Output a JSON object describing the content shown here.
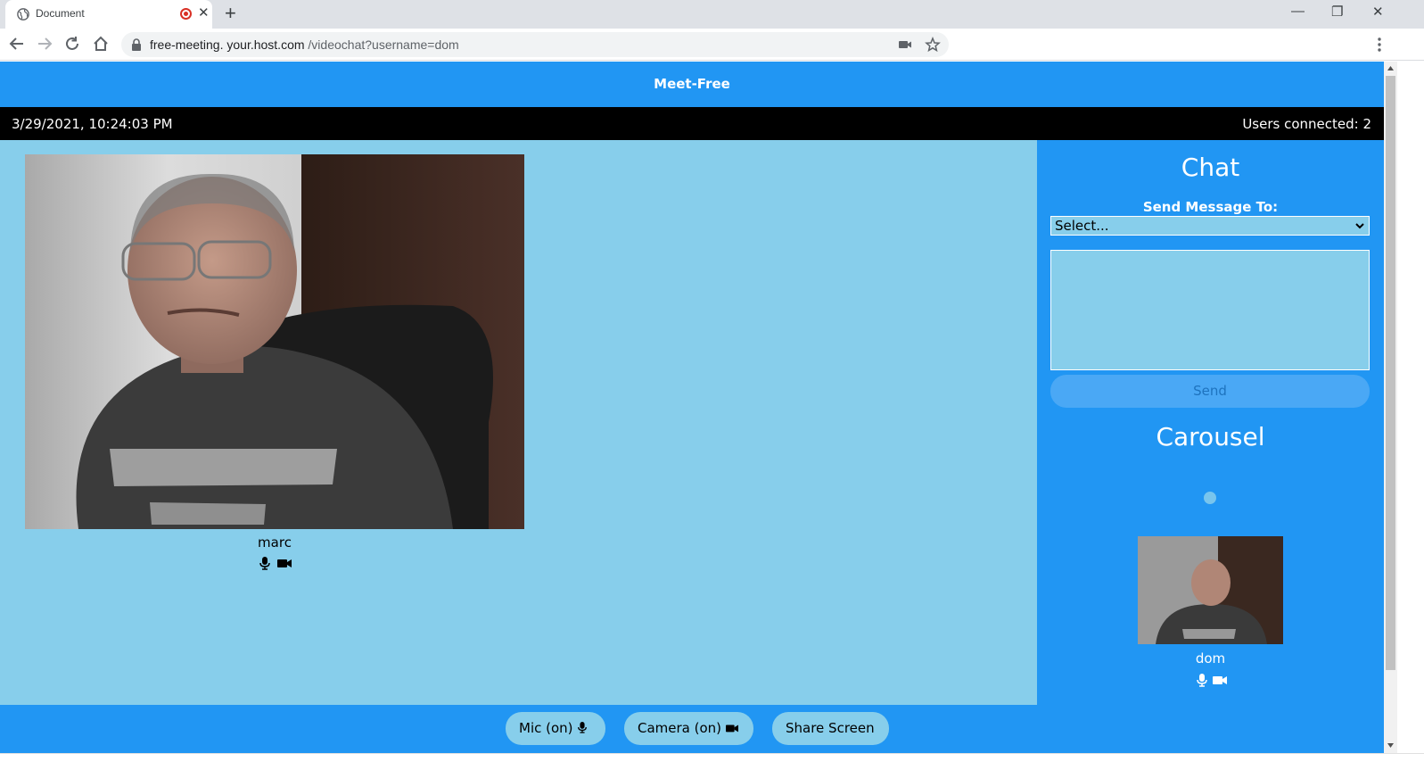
{
  "browser": {
    "tab_title": "Document",
    "url_host": "free-meeting. your.host.com",
    "url_path": " /videochat?username=dom",
    "new_tab_glyph": "+",
    "close_glyph": "✕",
    "minimize_glyph": "—",
    "restore_glyph": "❐",
    "window_close_glyph": "✕"
  },
  "app": {
    "title": "Meet-Free",
    "datetime": "3/29/2021, 10:24:03 PM",
    "users_connected": "Users connected: 2"
  },
  "main_video": {
    "name": "marc",
    "mic_icon": "microphone-icon",
    "camera_icon": "video-camera-icon"
  },
  "chat": {
    "title": "Chat",
    "send_to_label": "Send Message To:",
    "recipient_selected": "Select...",
    "message_value": "",
    "send_label": "Send"
  },
  "carousel": {
    "title": "Carousel",
    "thumb_name": "dom"
  },
  "controls": {
    "mic_label": "Mic (on)",
    "camera_label": "Camera (on)",
    "share_label": "Share Screen"
  },
  "colors": {
    "app_blue": "#2196f3",
    "sky_blue": "#87ceeb",
    "status_black": "#000000"
  }
}
